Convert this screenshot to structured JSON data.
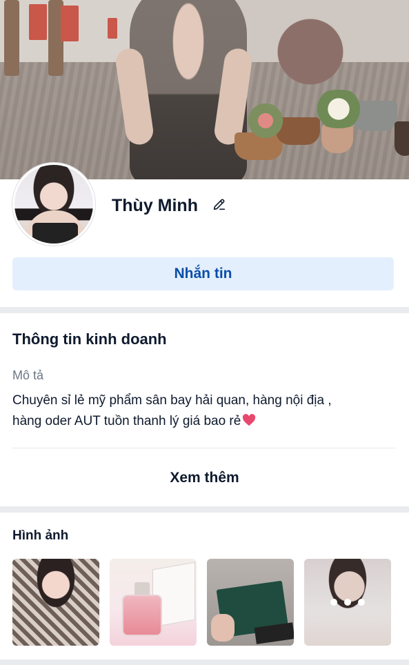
{
  "profile": {
    "name": "Thùy Minh",
    "message_button": "Nhắn tin"
  },
  "business": {
    "title": "Thông tin kinh doanh",
    "description_label": "Mô tả",
    "description_line1": "Chuyên sỉ lẻ mỹ phẩm sân bay hải quan, hàng nội địa ,",
    "description_line2": "hàng oder AUT tuồn thanh lý giá bao rẻ",
    "more_button": "Xem thêm"
  },
  "photos": {
    "title": "Hình ảnh",
    "items": [
      "photo-woman-plaid-top",
      "photo-perfume-bottle",
      "photo-marc-jacobs-box",
      "photo-woman-more"
    ],
    "more_indicator_icon": "more-dots-icon"
  },
  "colors": {
    "accent": "#0a4ea8",
    "button_bg": "#e4effd",
    "separator": "#e9ebee",
    "heart": "#e8486e"
  }
}
